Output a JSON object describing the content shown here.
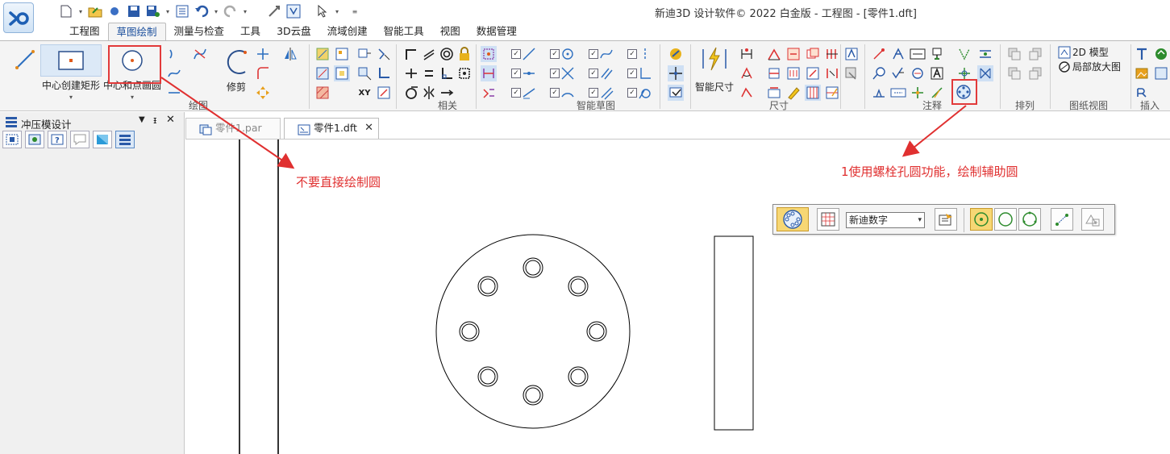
{
  "window": {
    "title": "新迪3D 设计软件© 2022 白金版 - 工程图 - [零件1.dft]"
  },
  "quick_access": {
    "items": [
      "new-doc-icon",
      "open-folder-icon",
      "save-icon",
      "save-as-icon",
      "properties-icon",
      "undo-icon",
      "redo-icon",
      "select-icon",
      "customize-icon"
    ]
  },
  "ribbon_tabs": [
    {
      "label": "工程图",
      "active": false
    },
    {
      "label": "草图绘制",
      "active": true
    },
    {
      "label": "测量与检查",
      "active": false
    },
    {
      "label": "工具",
      "active": false
    },
    {
      "label": "3D云盘",
      "active": false
    },
    {
      "label": "流域创建",
      "active": false
    },
    {
      "label": "智能工具",
      "active": false
    },
    {
      "label": "视图",
      "active": false
    },
    {
      "label": "数据管理",
      "active": false
    }
  ],
  "ribbon": {
    "center_rect_label": "中心创建矩形",
    "center_circle_label": "中心和点画圆",
    "trim_label": "修剪",
    "smart_dim_label": "智能尺寸",
    "model_2d_label": "2D 模型",
    "detail_view_label": "局部放大图",
    "groups": {
      "draw": "绘图",
      "relate": "相关",
      "smart_sketch": "智能草图",
      "dimension": "尺寸",
      "annotation": "注释",
      "arrange": "排列",
      "drawing_view": "图纸视图",
      "insert": "插入"
    }
  },
  "panel": {
    "title": "冲压模设计"
  },
  "doc_tabs": [
    {
      "label": "零件1.par",
      "active": false
    },
    {
      "label": "零件1.dft",
      "active": true
    }
  ],
  "command_bar": {
    "font_value": "新迪数字"
  },
  "annotations": {
    "left_note": "不要直接绘制圆",
    "right_note": "1使用螺栓孔圆功能，绘制辅助圆"
  },
  "colors": {
    "annotation_red": "#e03030",
    "accent_blue": "#1a4e9c",
    "active_button": "#f7d774"
  }
}
